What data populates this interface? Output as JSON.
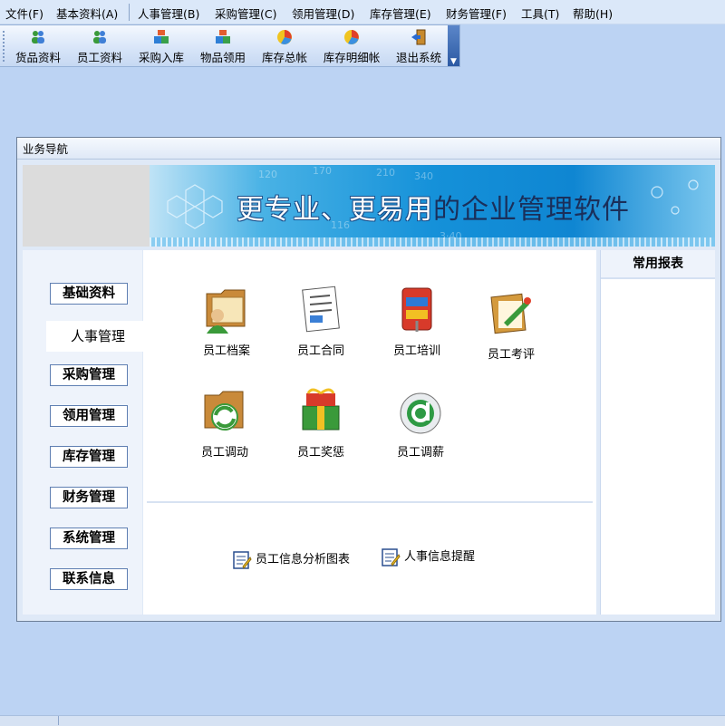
{
  "menu": [
    {
      "label": "文件(F)"
    },
    {
      "label": "基本资料(A)"
    },
    {
      "label": "人事管理(B)"
    },
    {
      "label": "采购管理(C)"
    },
    {
      "label": "领用管理(D)"
    },
    {
      "label": "库存管理(E)"
    },
    {
      "label": "财务管理(F)"
    },
    {
      "label": "工具(T)"
    },
    {
      "label": "帮助(H)"
    }
  ],
  "toolbar": [
    {
      "label": "货品资料",
      "icon": "people-icon"
    },
    {
      "label": "员工资料",
      "icon": "people-icon"
    },
    {
      "label": "采购入库",
      "icon": "boxes-icon"
    },
    {
      "label": "物品领用",
      "icon": "boxes-icon"
    },
    {
      "label": "库存总帐",
      "icon": "pie-chart-icon"
    },
    {
      "label": "库存明细帐",
      "icon": "pie-chart-icon"
    },
    {
      "label": "退出系统",
      "icon": "exit-door-icon"
    }
  ],
  "window": {
    "title": "业务导航",
    "banner": {
      "part1": "更专业、更易用",
      "part2": "的企业管理软件"
    }
  },
  "nav": [
    {
      "label": "基础资料"
    },
    {
      "label": "人事管理",
      "active": true
    },
    {
      "label": "采购管理"
    },
    {
      "label": "领用管理"
    },
    {
      "label": "库存管理"
    },
    {
      "label": "财务管理"
    },
    {
      "label": "系统管理"
    },
    {
      "label": "联系信息"
    }
  ],
  "modules": [
    {
      "label": "员工档案",
      "icon": "employee-file-icon"
    },
    {
      "label": "员工合同",
      "icon": "contract-icon"
    },
    {
      "label": "员工培训",
      "icon": "training-icon"
    },
    {
      "label": "员工考评",
      "icon": "evaluation-icon"
    },
    {
      "label": "员工调动",
      "icon": "transfer-icon"
    },
    {
      "label": "员工奖惩",
      "icon": "reward-gift-icon"
    },
    {
      "label": "员工调薪",
      "icon": "salary-icon"
    }
  ],
  "quick_links": [
    {
      "label": "员工信息分析图表",
      "icon": "report-icon"
    },
    {
      "label": "人事信息提醒",
      "icon": "report-icon"
    }
  ],
  "right_panel": {
    "title": "常用报表"
  },
  "colors": {
    "accent": "#1591d9",
    "window_bg": "#dfe9f7",
    "desktop_bg": "#bcd3f3"
  }
}
